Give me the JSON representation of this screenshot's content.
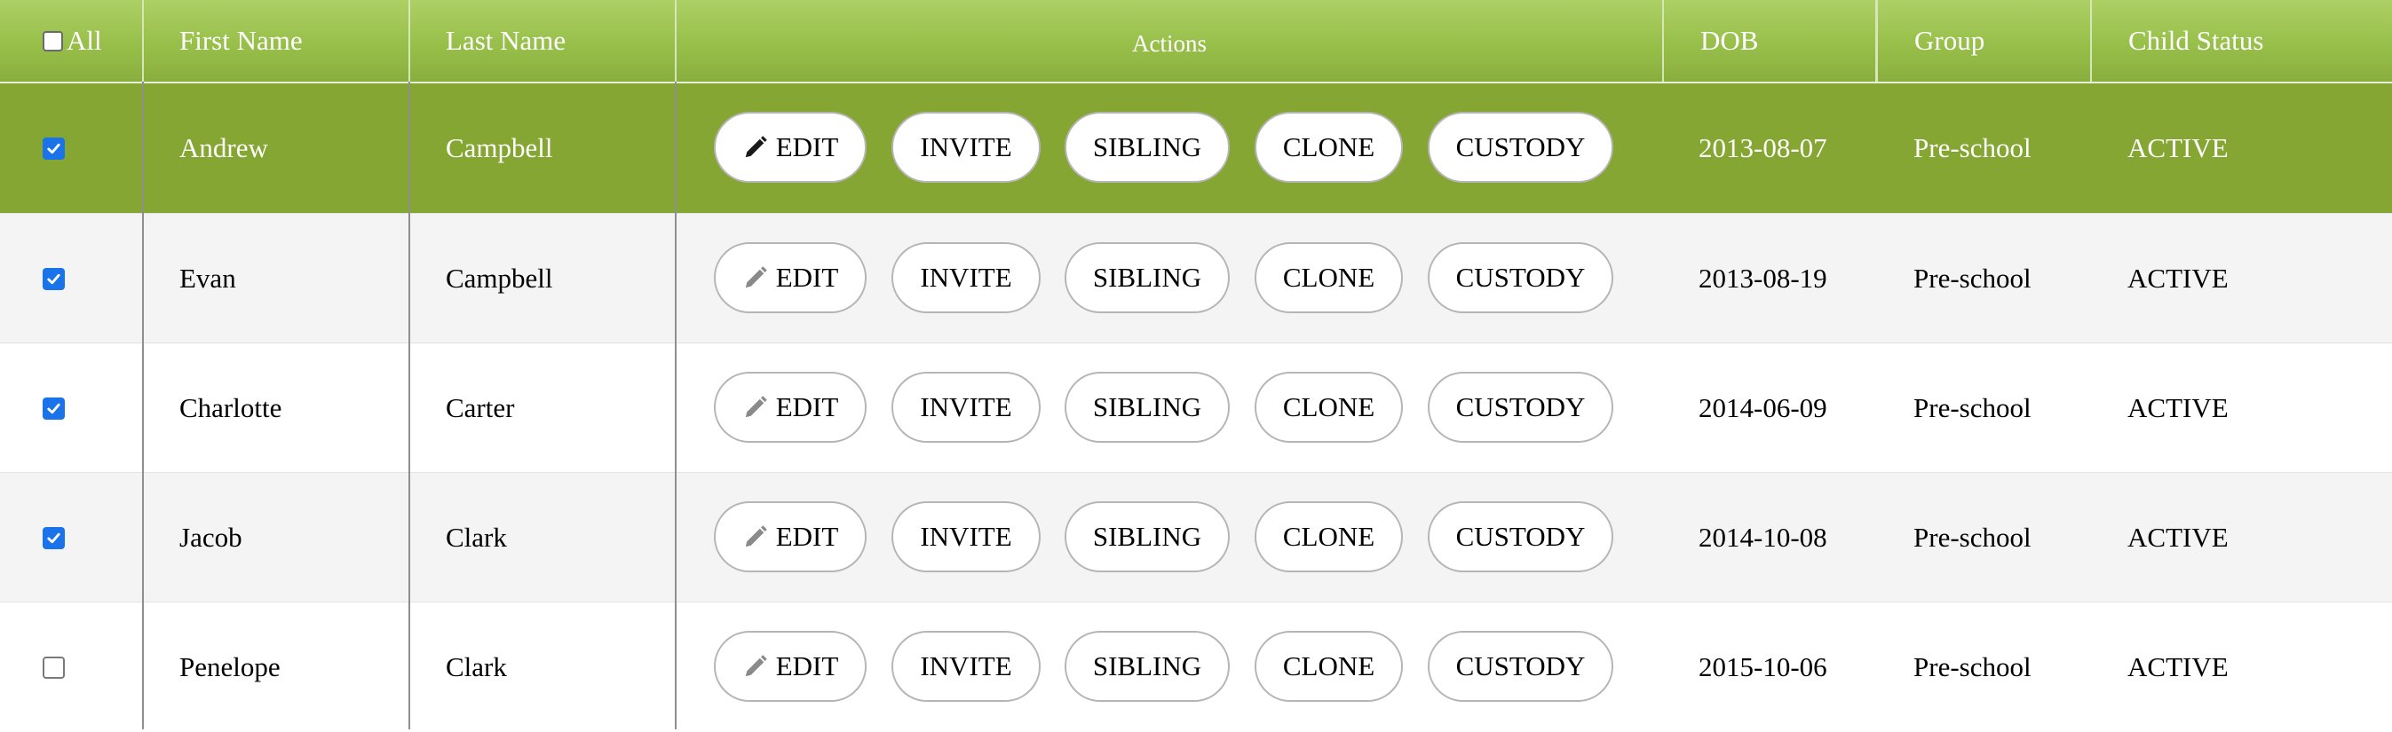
{
  "header": {
    "select_all_label": "All",
    "columns": {
      "first_name": "First Name",
      "last_name": "Last Name",
      "actions": "Actions",
      "dob": "DOB",
      "group": "Group",
      "child_status": "Child Status"
    }
  },
  "actions": {
    "edit": "EDIT",
    "invite": "INVITE",
    "sibling": "SIBLING",
    "clone": "CLONE",
    "custody": "CUSTODY"
  },
  "colors": {
    "header_green": "#98bf4a",
    "selected_row": "#85a632",
    "checkbox_blue": "#1a73e8"
  },
  "rows": [
    {
      "checked": true,
      "highlighted": true,
      "first_name": "Andrew",
      "last_name": "Campbell",
      "dob": "2013-08-07",
      "group": "Pre-school",
      "status": "ACTIVE"
    },
    {
      "checked": true,
      "highlighted": false,
      "first_name": "Evan",
      "last_name": "Campbell",
      "dob": "2013-08-19",
      "group": "Pre-school",
      "status": "ACTIVE"
    },
    {
      "checked": true,
      "highlighted": false,
      "first_name": "Charlotte",
      "last_name": "Carter",
      "dob": "2014-06-09",
      "group": "Pre-school",
      "status": "ACTIVE"
    },
    {
      "checked": true,
      "highlighted": false,
      "first_name": "Jacob",
      "last_name": "Clark",
      "dob": "2014-10-08",
      "group": "Pre-school",
      "status": "ACTIVE"
    },
    {
      "checked": false,
      "highlighted": false,
      "first_name": "Penelope",
      "last_name": "Clark",
      "dob": "2015-10-06",
      "group": "Pre-school",
      "status": "ACTIVE"
    }
  ]
}
